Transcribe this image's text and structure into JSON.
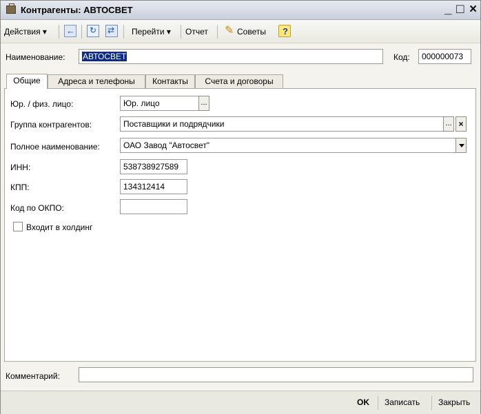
{
  "window": {
    "title": "Контрагенты: АВТОСВЕТ",
    "minimize": "_",
    "maximize": "□",
    "close": "×"
  },
  "toolbar": {
    "actions": "Действия ▾",
    "goto": "Перейти ▾",
    "report": "Отчет",
    "tips": "Советы"
  },
  "form": {
    "name_label": "Наименование:",
    "name_value": "АВТОСВЕТ",
    "code_label": "Код:",
    "code_value": "000000073",
    "comment_label": "Комментарий:",
    "comment_value": ""
  },
  "tabs": [
    {
      "label": "Общие"
    },
    {
      "label": "Адреса и телефоны"
    },
    {
      "label": "Контакты"
    },
    {
      "label": "Счета и договоры"
    }
  ],
  "general": {
    "entity_label": "Юр. / физ. лицо:",
    "entity_value": "Юр. лицо",
    "group_label": "Группа контрагентов:",
    "group_value": "Поставщики и подрядчики",
    "fullname_label": "Полное наименование:",
    "fullname_value": "ОАО Завод \"Автосвет\"",
    "inn_label": "ИНН:",
    "inn_value": "538738927589",
    "kpp_label": "КПП:",
    "kpp_value": "134312414",
    "okpo_label": "Код по ОКПО:",
    "okpo_value": "",
    "holding_label": "Входит в холдинг",
    "holding_checked": false
  },
  "buttons": {
    "dots": "...",
    "clear": "×",
    "ok": "OK",
    "save": "Записать",
    "close": "Закрыть"
  }
}
